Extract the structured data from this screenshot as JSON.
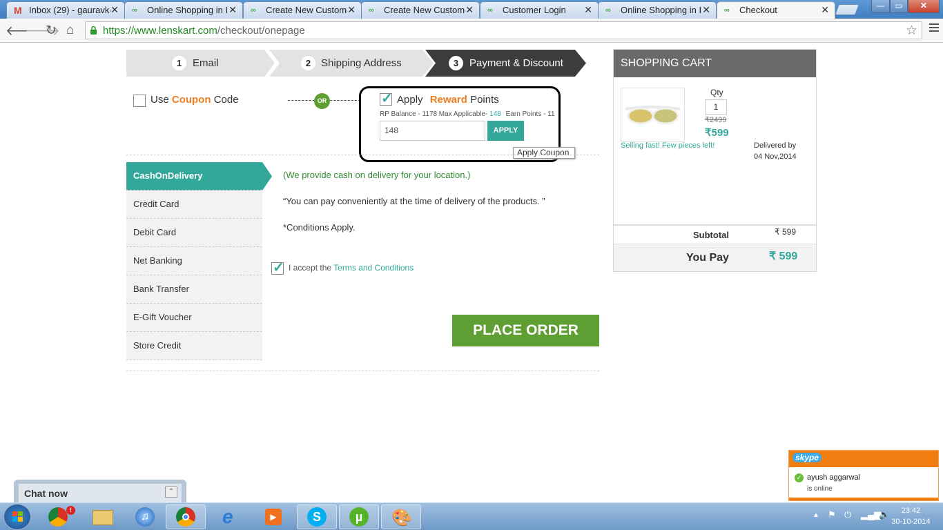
{
  "browser": {
    "tabs": [
      {
        "label": "Inbox (29) - gauravk@",
        "icon": "gmail-icon"
      },
      {
        "label": "Online Shopping in In",
        "icon": "lenskart-icon"
      },
      {
        "label": "Create New Customer",
        "icon": "lenskart-icon"
      },
      {
        "label": "Create New Customer",
        "icon": "lenskart-icon"
      },
      {
        "label": "Customer Login",
        "icon": "lenskart-icon"
      },
      {
        "label": "Online Shopping in In",
        "icon": "lenskart-icon"
      },
      {
        "label": "Checkout",
        "icon": "lenskart-icon"
      }
    ],
    "url_host": "https://www.lenskart.com",
    "url_path": "/checkout/onepage"
  },
  "steps": [
    {
      "num": "1",
      "label": "Email"
    },
    {
      "num": "2",
      "label": "Shipping Address"
    },
    {
      "num": "3",
      "label": "Payment & Discount"
    }
  ],
  "coupon": {
    "use": "Use",
    "coupon": "Coupon",
    "code": "Code",
    "or": "OR"
  },
  "reward": {
    "apply": "Apply",
    "reward": "Reward",
    "points": "Points",
    "rp_balance": "RP Balance - 1178 Max  Applicable-",
    "applicable_value": "148",
    "earn_points": "Earn Points - 11",
    "input_value": "148",
    "apply_button": "APPLY",
    "tooltip": "Apply Coupon"
  },
  "payment_methods": [
    "CashOnDelivery",
    "Credit Card",
    "Debit Card",
    "Net Banking",
    "Bank Transfer",
    "E-Gift Voucher",
    "Store Credit"
  ],
  "cod": {
    "line1": "(We provide cash on delivery for your location.)",
    "line2": "“You can pay conveniently at the time of delivery of the products. ”",
    "line3": "*Conditions Apply."
  },
  "terms": {
    "prefix": "I accept the",
    "link": "Terms and Conditions"
  },
  "place_order": "PLACE ORDER",
  "cart": {
    "title": "SHOPPING CART",
    "qty_label": "Qty",
    "qty_value": "1",
    "mrp": "₹2499",
    "price": "₹599",
    "stock_note": "Selling fast! Few pieces left!",
    "delivered_by": "Delivered by",
    "delivery_date": "04 Nov,2014",
    "subtotal_label": "Subtotal",
    "subtotal_value": "₹ 599",
    "you_pay_label": "You Pay",
    "you_pay_value": "₹ 599"
  },
  "chat": {
    "label": "Chat now"
  },
  "skype": {
    "brand": "skype",
    "contact": "ayush aggarwal",
    "status": "is online"
  },
  "clock": {
    "time": "23:42",
    "date": "30-10-2014"
  },
  "colors": {
    "teal": "#33a89a",
    "orange": "#f07e22",
    "green": "#5f9e32",
    "cart_head": "#6a6a6a"
  }
}
